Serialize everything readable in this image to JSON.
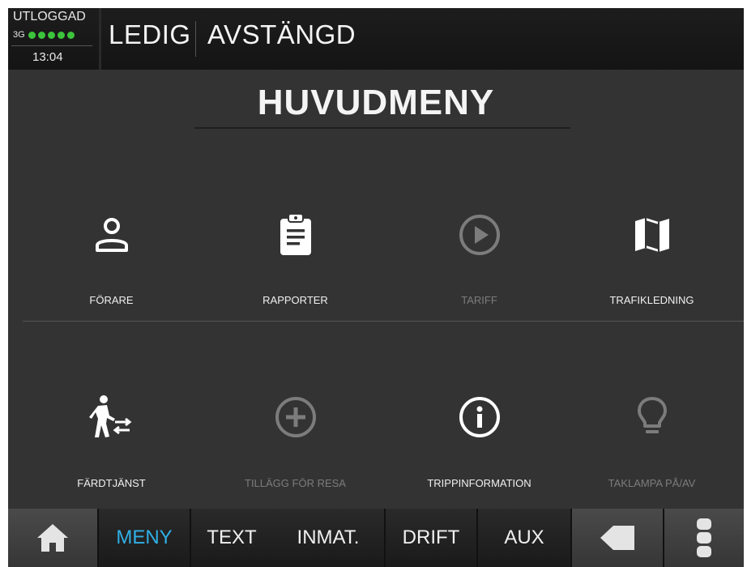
{
  "header": {
    "login_status": "UTLOGGAD",
    "network": "3G",
    "signal_bars": 5,
    "time": "13:04",
    "state_primary": "LEDIG",
    "state_secondary": "AVSTÄNGD"
  },
  "page": {
    "title": "HUVUDMENY"
  },
  "menu": {
    "items": [
      {
        "label": "FÖRARE",
        "icon": "person-icon",
        "enabled": true
      },
      {
        "label": "RAPPORTER",
        "icon": "clipboard-icon",
        "enabled": true
      },
      {
        "label": "TARIFF",
        "icon": "play-circle-icon",
        "enabled": false
      },
      {
        "label": "TRAFIKLEDNING",
        "icon": "map-icon",
        "enabled": true
      },
      {
        "label": "FÄRDTJÄNST",
        "icon": "walker-transfer-icon",
        "enabled": true
      },
      {
        "label": "TILLÄGG FÖR RESA",
        "icon": "plus-circle-icon",
        "enabled": false
      },
      {
        "label": "TRIPPINFORMATION",
        "icon": "info-circle-icon",
        "enabled": true
      },
      {
        "label": "TAKLAMPA PÅ/AV",
        "icon": "lightbulb-icon",
        "enabled": false
      }
    ]
  },
  "nav": {
    "home_icon": "home-icon",
    "tabs": [
      {
        "label": "MENY",
        "active": true
      },
      {
        "label": "TEXT",
        "active": false
      },
      {
        "label": "INMAT.",
        "active": false
      },
      {
        "label": "DRIFT",
        "active": false
      },
      {
        "label": "AUX",
        "active": false
      }
    ],
    "back_icon": "back-arrow-icon",
    "more_icon": "more-vertical-icon"
  },
  "colors": {
    "background": "#333333",
    "header": "#1a1a1a",
    "active_tab": "#2fb0e6",
    "signal": "#3cc43c",
    "disabled": "#7c7c7c"
  }
}
